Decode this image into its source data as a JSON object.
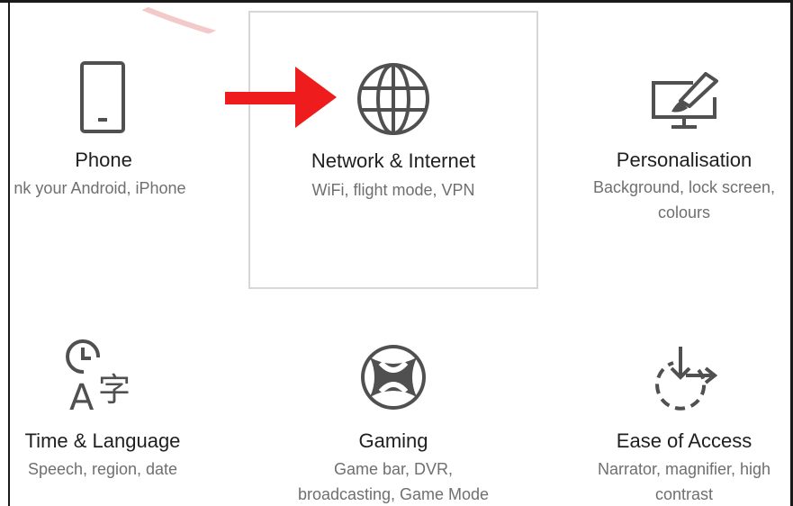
{
  "tiles": [
    {
      "id": "phone",
      "title": "Phone",
      "desc_lines": [
        "nk your Android, iPhone"
      ],
      "icon": "phone-icon"
    },
    {
      "id": "network",
      "title": "Network & Internet",
      "desc_lines": [
        "WiFi, flight mode, VPN"
      ],
      "icon": "globe-icon"
    },
    {
      "id": "personalisation",
      "title": "Personalisation",
      "desc_lines": [
        "Background, lock screen,",
        "colours"
      ],
      "icon": "paintbrush-monitor-icon"
    },
    {
      "id": "time-language",
      "title": "Time & Language",
      "desc_lines": [
        "Speech, region, date"
      ],
      "icon": "clock-language-icon"
    },
    {
      "id": "gaming",
      "title": "Gaming",
      "desc_lines": [
        "Game bar, DVR,",
        "broadcasting, Game Mode"
      ],
      "icon": "xbox-icon"
    },
    {
      "id": "ease-of-access",
      "title": "Ease of Access",
      "desc_lines": [
        "Narrator, magnifier, high",
        "contrast"
      ],
      "icon": "ease-of-access-icon"
    }
  ],
  "annotation": {
    "arrow_color": "#ee1c1c",
    "icon": "red-arrow-icon"
  },
  "colors": {
    "title": "#1f1f1f",
    "desc": "#6f6f6f",
    "icon": "#505050",
    "hover_border": "#d7d7d7"
  }
}
